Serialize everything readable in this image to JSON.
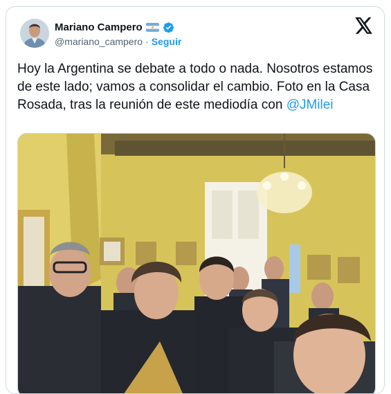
{
  "author": {
    "name": "Mariano Campero",
    "handle": "@mariano_campero",
    "separator": "·",
    "follow_label": "Seguir"
  },
  "icons": {
    "flag": "argentina-flag-icon",
    "verified": "verified-badge-icon",
    "logo": "x-logo-icon"
  },
  "colors": {
    "accent": "#1d9bf0",
    "text": "#0f1419",
    "muted": "#536471"
  },
  "tweet": {
    "text": "Hoy la Argentina se debate a todo o nada. Nosotros estamos de este lado; vamos a consolidar el cambio. Foto en la Casa Rosada, tras la reunión de este mediodía con ",
    "mention": "@JMilei"
  }
}
